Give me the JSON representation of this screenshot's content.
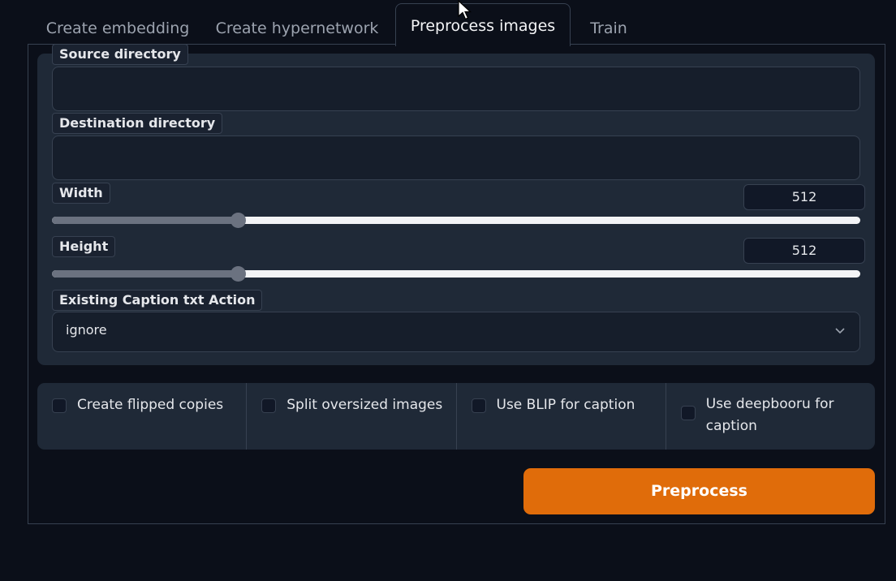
{
  "tabs": [
    {
      "label": "Create embedding"
    },
    {
      "label": "Create hypernetwork"
    },
    {
      "label": "Preprocess images"
    },
    {
      "label": "Train"
    }
  ],
  "active_tab_index": 2,
  "form": {
    "source": {
      "label": "Source directory",
      "value": ""
    },
    "destination": {
      "label": "Destination directory",
      "value": ""
    },
    "width": {
      "label": "Width",
      "value": "512",
      "slider_fraction": 0.23
    },
    "height": {
      "label": "Height",
      "value": "512",
      "slider_fraction": 0.23
    },
    "caption_action": {
      "label": "Existing Caption txt Action",
      "value": "ignore"
    }
  },
  "checkboxes": [
    {
      "label": "Create flipped copies",
      "checked": false
    },
    {
      "label": "Split oversized images",
      "checked": false
    },
    {
      "label": "Use BLIP for caption",
      "checked": false
    },
    {
      "label": "Use deepbooru for caption",
      "checked": false
    }
  ],
  "buttons": {
    "preprocess": "Preprocess"
  },
  "colors": {
    "accent": "#e06c0a",
    "background": "#0b0f19",
    "panel": "#1f2937"
  },
  "icons": [
    "mouse-cursor-icon",
    "chevron-down-icon"
  ]
}
